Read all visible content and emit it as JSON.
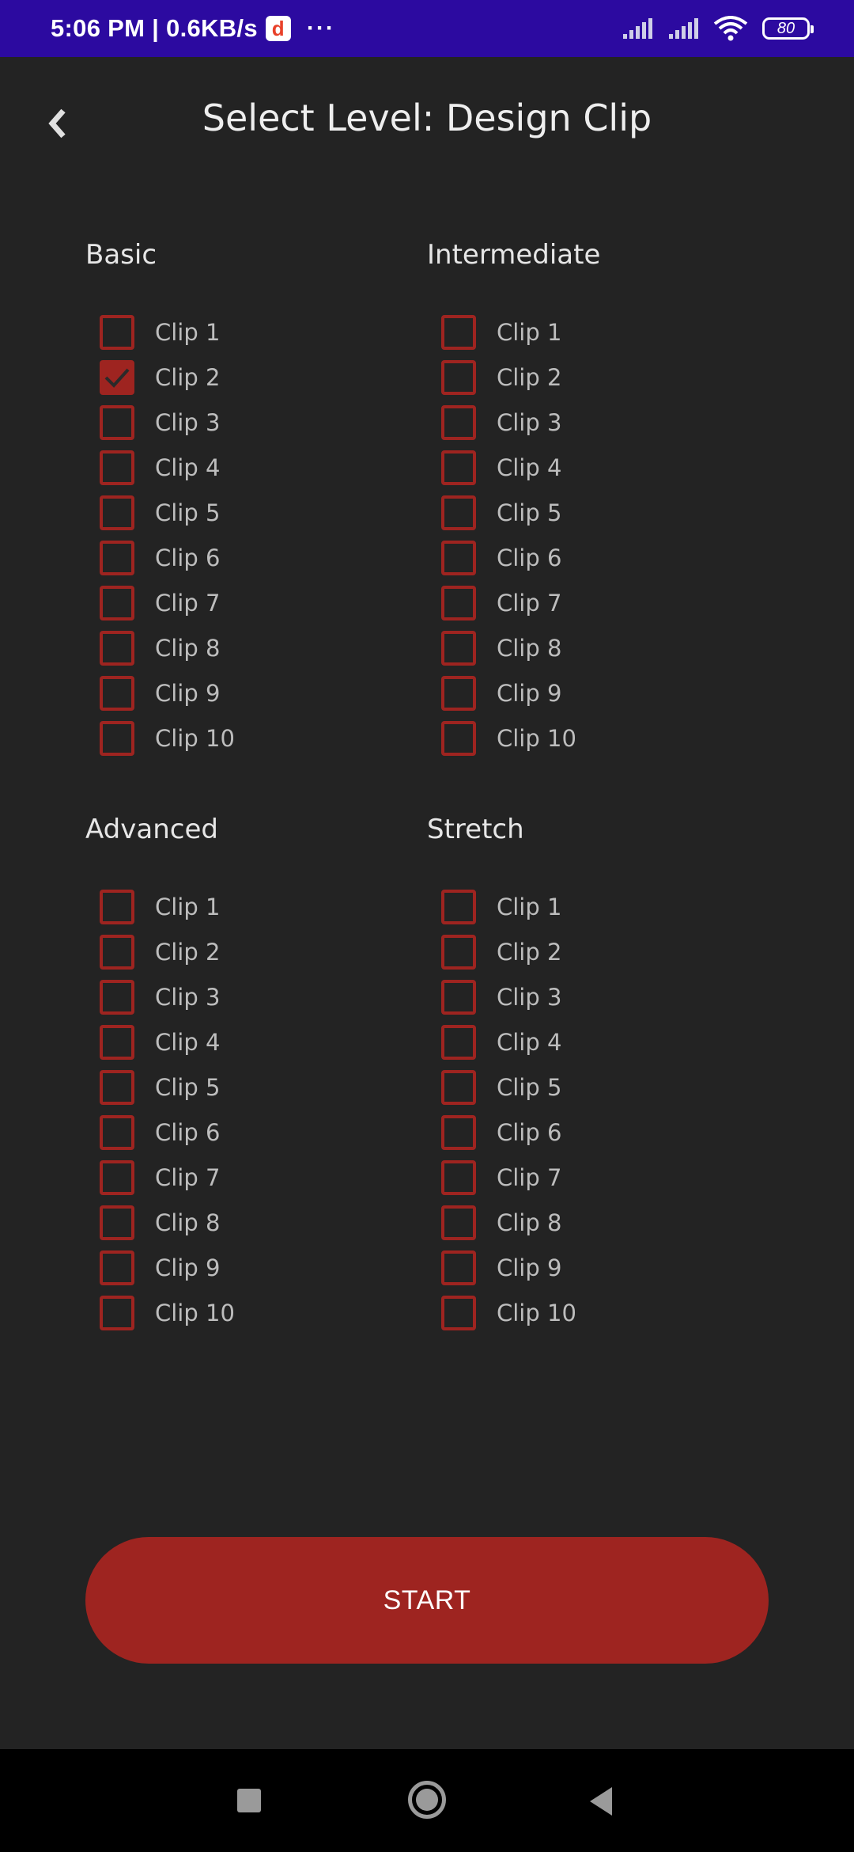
{
  "status_bar": {
    "time": "5:06 PM | 0.6KB/s",
    "app_icon": "d",
    "more": "···",
    "battery": "80"
  },
  "header": {
    "title": "Select Level: Design Clip",
    "back_icon": "chevron-left-icon"
  },
  "levels": [
    {
      "title": "Basic",
      "clips": [
        {
          "label": "Clip 1",
          "checked": false
        },
        {
          "label": "Clip 2",
          "checked": true
        },
        {
          "label": "Clip 3",
          "checked": false
        },
        {
          "label": "Clip 4",
          "checked": false
        },
        {
          "label": "Clip 5",
          "checked": false
        },
        {
          "label": "Clip 6",
          "checked": false
        },
        {
          "label": "Clip 7",
          "checked": false
        },
        {
          "label": "Clip 8",
          "checked": false
        },
        {
          "label": "Clip 9",
          "checked": false
        },
        {
          "label": "Clip 10",
          "checked": false
        }
      ]
    },
    {
      "title": "Intermediate",
      "clips": [
        {
          "label": "Clip 1",
          "checked": false
        },
        {
          "label": "Clip 2",
          "checked": false
        },
        {
          "label": "Clip 3",
          "checked": false
        },
        {
          "label": "Clip 4",
          "checked": false
        },
        {
          "label": "Clip 5",
          "checked": false
        },
        {
          "label": "Clip 6",
          "checked": false
        },
        {
          "label": "Clip 7",
          "checked": false
        },
        {
          "label": "Clip 8",
          "checked": false
        },
        {
          "label": "Clip 9",
          "checked": false
        },
        {
          "label": "Clip 10",
          "checked": false
        }
      ]
    },
    {
      "title": "Advanced",
      "clips": [
        {
          "label": "Clip 1",
          "checked": false
        },
        {
          "label": "Clip 2",
          "checked": false
        },
        {
          "label": "Clip 3",
          "checked": false
        },
        {
          "label": "Clip 4",
          "checked": false
        },
        {
          "label": "Clip 5",
          "checked": false
        },
        {
          "label": "Clip 6",
          "checked": false
        },
        {
          "label": "Clip 7",
          "checked": false
        },
        {
          "label": "Clip 8",
          "checked": false
        },
        {
          "label": "Clip 9",
          "checked": false
        },
        {
          "label": "Clip 10",
          "checked": false
        }
      ]
    },
    {
      "title": "Stretch",
      "clips": [
        {
          "label": "Clip 1",
          "checked": false
        },
        {
          "label": "Clip 2",
          "checked": false
        },
        {
          "label": "Clip 3",
          "checked": false
        },
        {
          "label": "Clip 4",
          "checked": false
        },
        {
          "label": "Clip 5",
          "checked": false
        },
        {
          "label": "Clip 6",
          "checked": false
        },
        {
          "label": "Clip 7",
          "checked": false
        },
        {
          "label": "Clip 8",
          "checked": false
        },
        {
          "label": "Clip 9",
          "checked": false
        },
        {
          "label": "Clip 10",
          "checked": false
        }
      ]
    }
  ],
  "start_button": {
    "label": "START"
  },
  "colors": {
    "status_bar": "#2c0aa0",
    "background": "#232323",
    "accent": "#9e2420"
  }
}
